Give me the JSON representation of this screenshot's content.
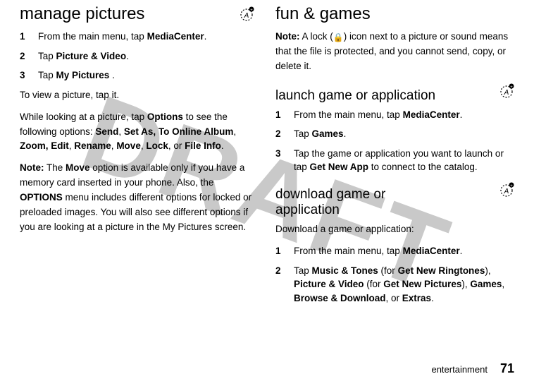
{
  "watermark": "DRAFT",
  "left": {
    "heading": "manage pictures",
    "steps": [
      {
        "num": "1",
        "pre": "From the main menu, tap  ",
        "bold": "MediaCenter",
        "post": "."
      },
      {
        "num": "2",
        "pre": "Tap ",
        "bold": "Picture & Video",
        "post": "."
      },
      {
        "num": "3",
        "pre": "Tap ",
        "bold": "My Pictures",
        "post": " ."
      }
    ],
    "view_para": "To view a picture, tap it.",
    "options_para_a": "While looking at a picture, tap ",
    "options_word": "Options",
    "options_para_b": " to see the following options: ",
    "opts_list": [
      "Send",
      "Set As, To Online Album",
      "Zoom, Edit",
      "Rename",
      "Move",
      "Lock"
    ],
    "opts_joiner_or": ", or ",
    "opts_last": "File Info",
    "opts_end": ".",
    "note_label": "Note:",
    "note_a": " The ",
    "note_move": "Move",
    "note_b": " option is available only if you have a memory card inserted in your phone. Also, the ",
    "note_options": "OPTIONS",
    "note_c": " menu includes different options for locked or preloaded images. You will also see different options if you are looking at a picture in the My Pictures screen."
  },
  "right": {
    "heading": "fun & games",
    "note_label": "Note:",
    "note_a": " A lock (",
    "note_b": ") icon next to a picture or sound means that the file is protected, and you cannot send, copy, or delete it.",
    "sub1": "launch game or application",
    "steps1": [
      {
        "num": "1",
        "pre": "From the main menu, tap  ",
        "bold": "MediaCenter",
        "post": "."
      },
      {
        "num": "2",
        "pre": "Tap ",
        "bold": "Games",
        "post": "."
      },
      {
        "num": "3",
        "pre": "Tap the game or application you want to launch or tap ",
        "bold": "Get New App",
        "post": " to connect to the catalog."
      }
    ],
    "sub2": "download game or application",
    "dl_intro": "Download a game or application:",
    "steps2": [
      {
        "num": "1",
        "pre": "From the main menu, tap  ",
        "bold": "MediaCenter",
        "post": "."
      }
    ],
    "step2_2": {
      "num": "2",
      "text_a": "Tap ",
      "b1": "Music & Tones",
      "text_b": " (for ",
      "b2": "Get New Ringtones",
      "text_c": "), ",
      "b3": "Picture & Video",
      "text_d": " (for ",
      "b4": "Get New Pictures",
      "text_e": "), ",
      "b5": "Games",
      "text_f": ", ",
      "b6": "Browse & Download",
      "text_g": ", or ",
      "b7": "Extras",
      "text_h": "."
    }
  },
  "footer": {
    "section": "entertainment",
    "page": "71"
  },
  "icons": {
    "lock": "🔒"
  }
}
